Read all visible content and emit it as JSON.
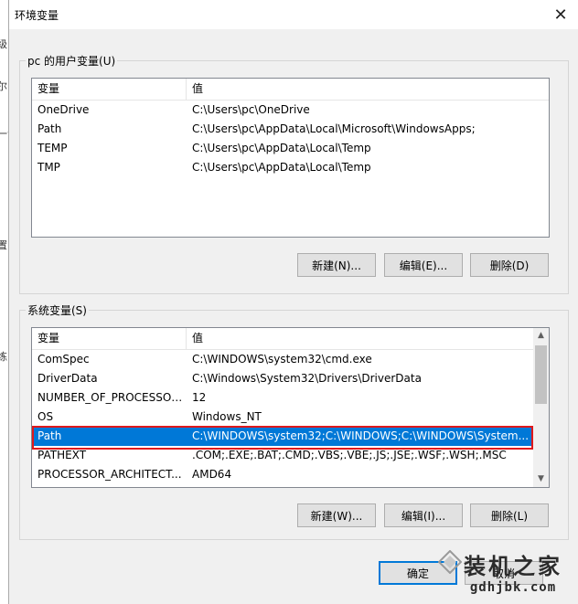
{
  "left_strip_chars": [
    "级",
    "尔",
    "一戈",
    "置",
    "练"
  ],
  "window": {
    "title": "环境变量",
    "close_glyph": "✕"
  },
  "user_vars": {
    "group_label": "pc 的用户变量(U)",
    "columns": [
      "变量",
      "值"
    ],
    "rows": [
      {
        "name": "OneDrive",
        "value": "C:\\Users\\pc\\OneDrive",
        "selected": false
      },
      {
        "name": "Path",
        "value": "C:\\Users\\pc\\AppData\\Local\\Microsoft\\WindowsApps;",
        "selected": false
      },
      {
        "name": "TEMP",
        "value": "C:\\Users\\pc\\AppData\\Local\\Temp",
        "selected": false
      },
      {
        "name": "TMP",
        "value": "C:\\Users\\pc\\AppData\\Local\\Temp",
        "selected": false
      }
    ],
    "buttons": {
      "new": "新建(N)...",
      "edit": "编辑(E)...",
      "delete": "删除(D)"
    }
  },
  "system_vars": {
    "group_label": "系统变量(S)",
    "columns": [
      "变量",
      "值"
    ],
    "rows": [
      {
        "name": "ComSpec",
        "value": "C:\\WINDOWS\\system32\\cmd.exe",
        "selected": false
      },
      {
        "name": "DriverData",
        "value": "C:\\Windows\\System32\\Drivers\\DriverData",
        "selected": false
      },
      {
        "name": "NUMBER_OF_PROCESSORS",
        "value": "12",
        "selected": false
      },
      {
        "name": "OS",
        "value": "Windows_NT",
        "selected": false
      },
      {
        "name": "Path",
        "value": "C:\\WINDOWS\\system32;C:\\WINDOWS;C:\\WINDOWS\\System...",
        "selected": true
      },
      {
        "name": "PATHEXT",
        "value": ".COM;.EXE;.BAT;.CMD;.VBS;.VBE;.JS;.JSE;.WSF;.WSH;.MSC",
        "selected": false
      },
      {
        "name": "PROCESSOR_ARCHITECT...",
        "value": "AMD64",
        "selected": false
      }
    ],
    "buttons": {
      "new": "新建(W)...",
      "edit": "编辑(I)...",
      "delete": "删除(L)"
    }
  },
  "footer": {
    "ok": "确定",
    "cancel": "取消"
  },
  "watermark": {
    "name": "装机之家",
    "url": "gdhjbk.com"
  },
  "colors": {
    "selection": "#0078d7",
    "highlight": "#e0191c",
    "primary_border": "#0078d7"
  }
}
